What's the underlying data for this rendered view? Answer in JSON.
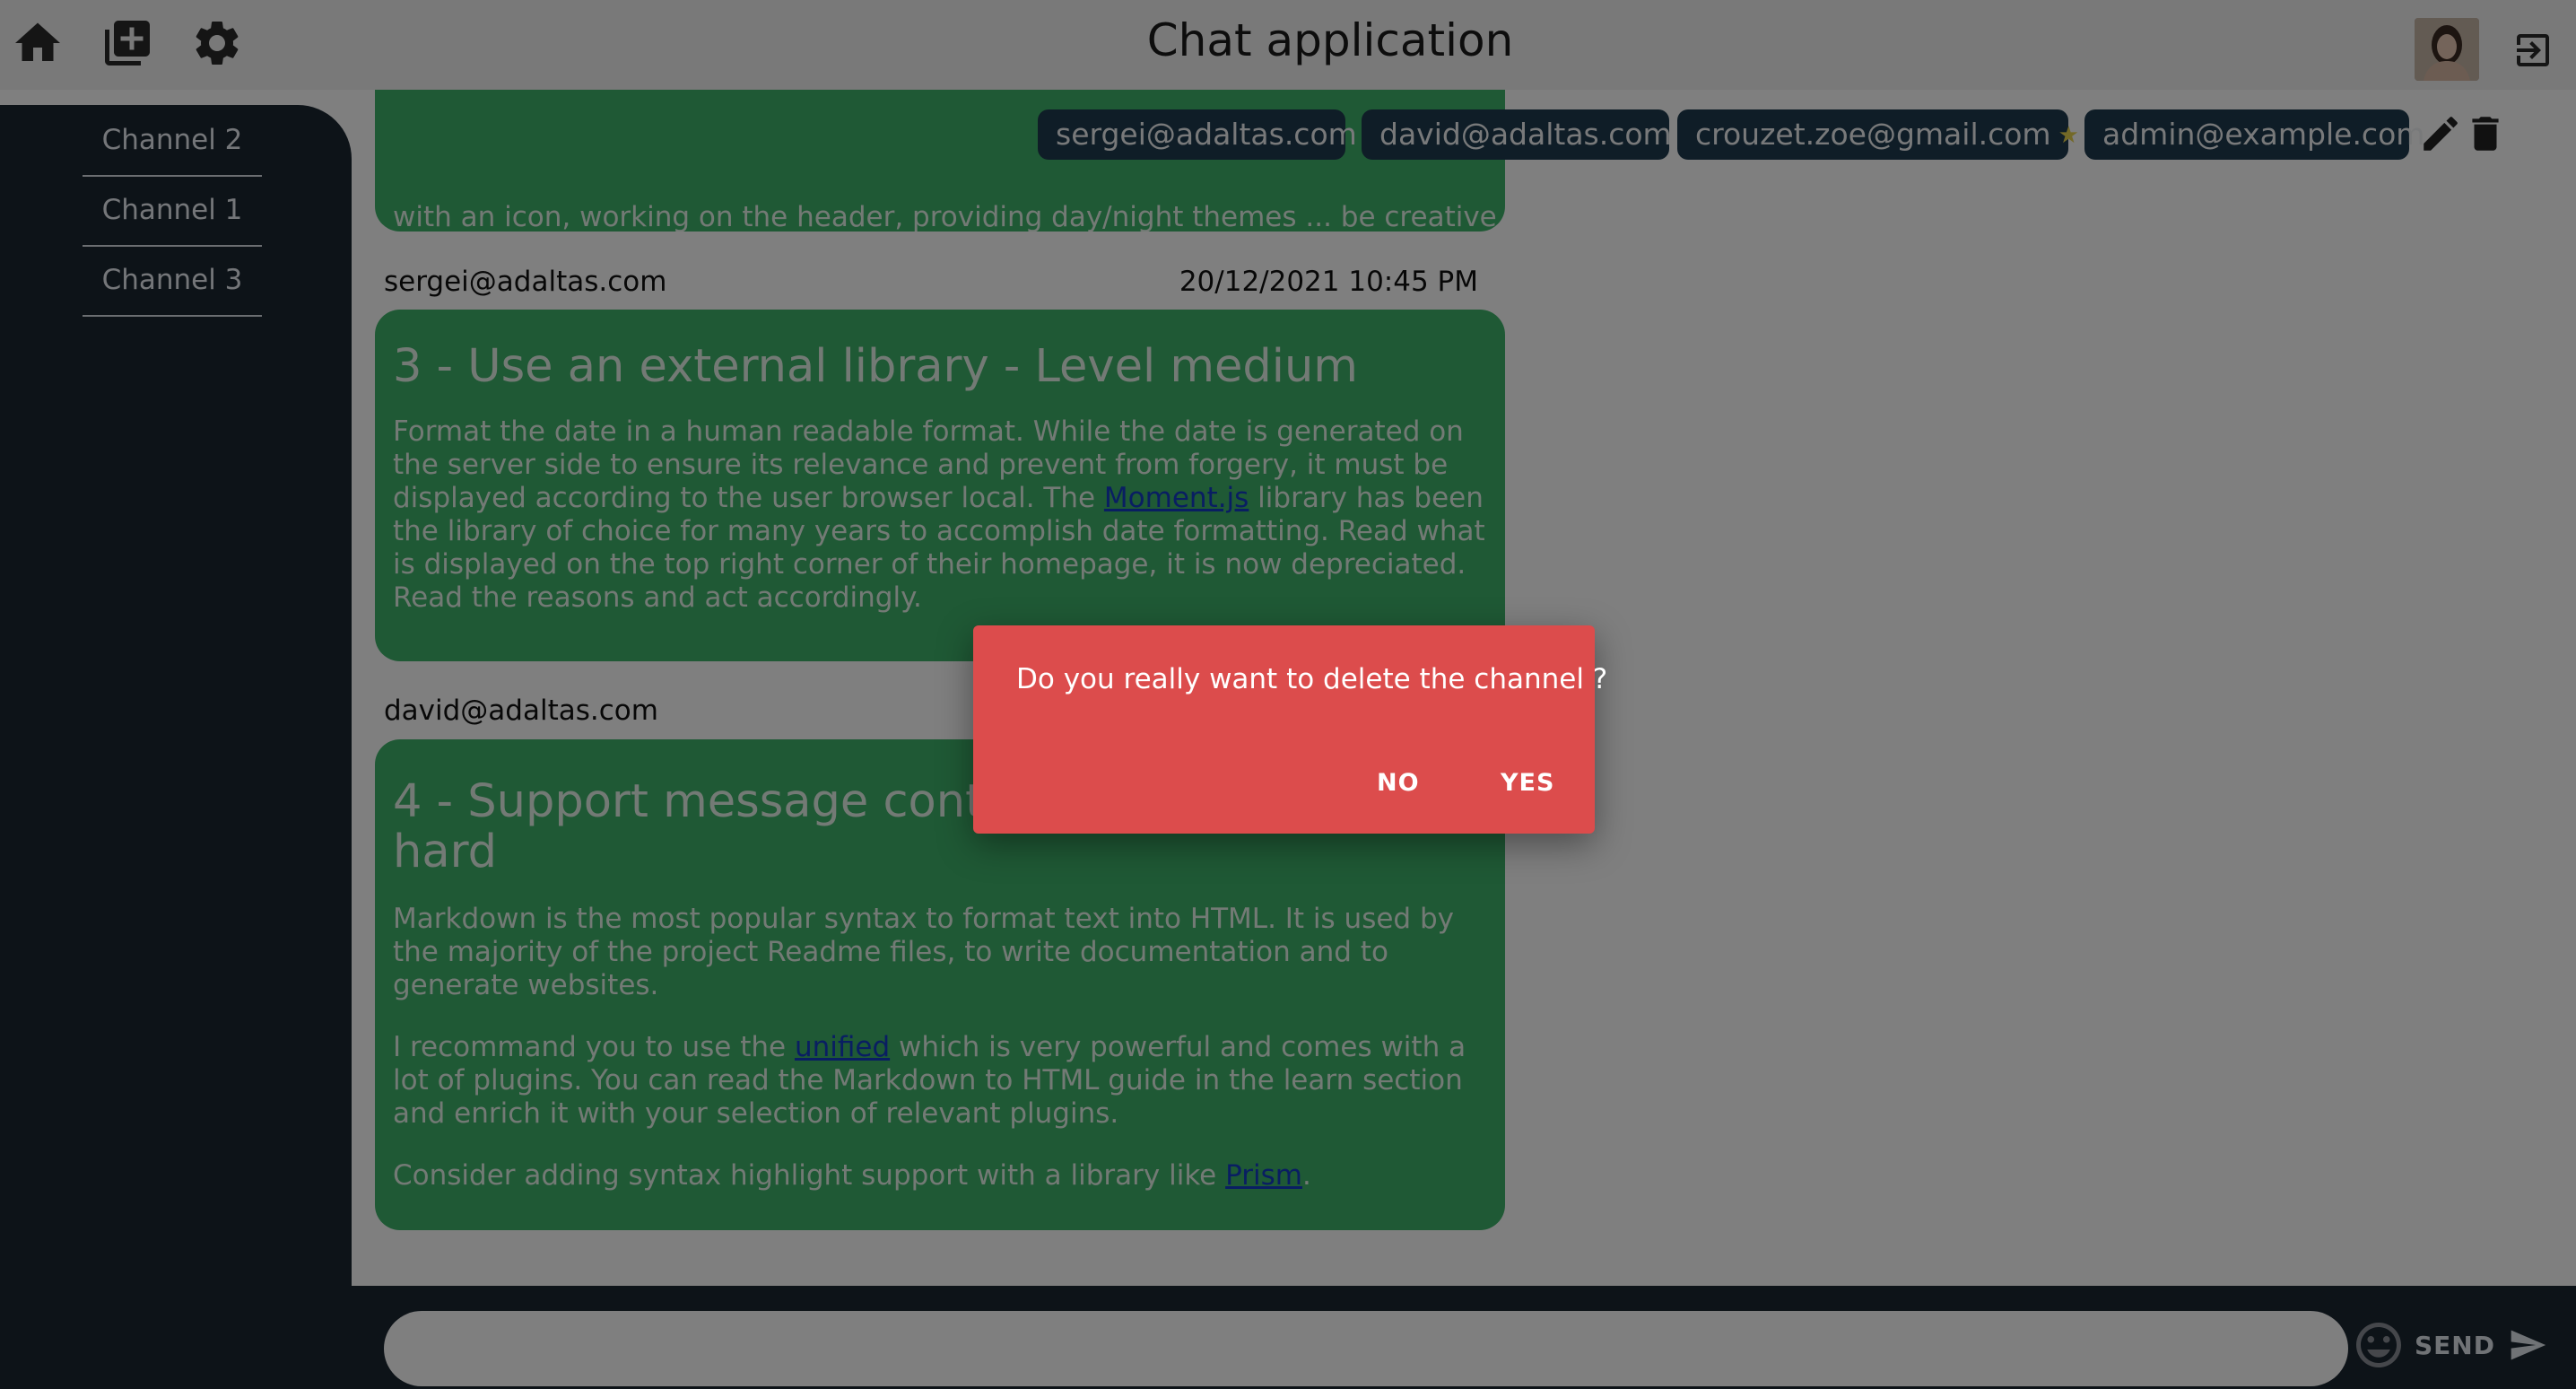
{
  "app": {
    "title": "Chat application"
  },
  "header": {
    "icons": [
      "home-icon",
      "add-channel-icon",
      "settings-icon",
      "logout-icon"
    ]
  },
  "sidebar": {
    "items": [
      {
        "label": "Channel 2"
      },
      {
        "label": "Channel 1"
      },
      {
        "label": "Channel 3"
      }
    ]
  },
  "channel": {
    "participants": [
      {
        "email": "sergei@adaltas.com",
        "owner": false
      },
      {
        "email": "david@adaltas.com",
        "owner": false
      },
      {
        "email": "crouzet.zoe@gmail.com",
        "owner": true,
        "badge": "★"
      },
      {
        "email": "admin@example.com",
        "owner": false
      }
    ],
    "actions": [
      "edit-icon",
      "delete-icon"
    ]
  },
  "messages": [
    {
      "body_partial": "with an icon, working on the header, providing day/night themes ... be creative"
    },
    {
      "author": "sergei@adaltas.com",
      "date": "20/12/2021 10:45 PM",
      "heading": "3 - Use an external library - Level medium",
      "p1_before": "Format the date in a human readable format. While the date is generated on the server side to ensure its relevance and prevent from forgery, it must be displayed according to the user browser local. The ",
      "p1_link": "Moment.js",
      "p1_after": " library has been the library of choice for many years to accomplish date formatting. Read what is displayed on the top right corner of their homepage, it is now depreciated. Read the reasons and act accordingly."
    },
    {
      "author": "david@adaltas.com",
      "heading": "4 - Support message conter",
      "heading_line2": "hard",
      "p1": "Markdown is the most popular syntax to format text into HTML. It is used by the majority of the project Readme files, to write documentation and to generate websites.",
      "p2_before": "I recommand you to use the ",
      "p2_link": "unified",
      "p2_after": " which is very powerful and comes with a lot of plugins. You can read the Markdown to HTML guide in the learn section and enrich it with your selection of relevant plugins.",
      "p3_before": "Consider adding syntax highlight support with a library like ",
      "p3_link": "Prism",
      "p3_after": "."
    }
  ],
  "composer": {
    "placeholder": "",
    "send_label": "SEND"
  },
  "dialog": {
    "question": "Do you really want to delete the channel ?",
    "no_label": "NO",
    "yes_label": "YES"
  },
  "colors": {
    "sidebar_bg": "#1a2631",
    "bubble_bg": "#3fb26a",
    "dialog_bg": "#dc4c4c",
    "chip_bg": "#1f3b4e"
  }
}
